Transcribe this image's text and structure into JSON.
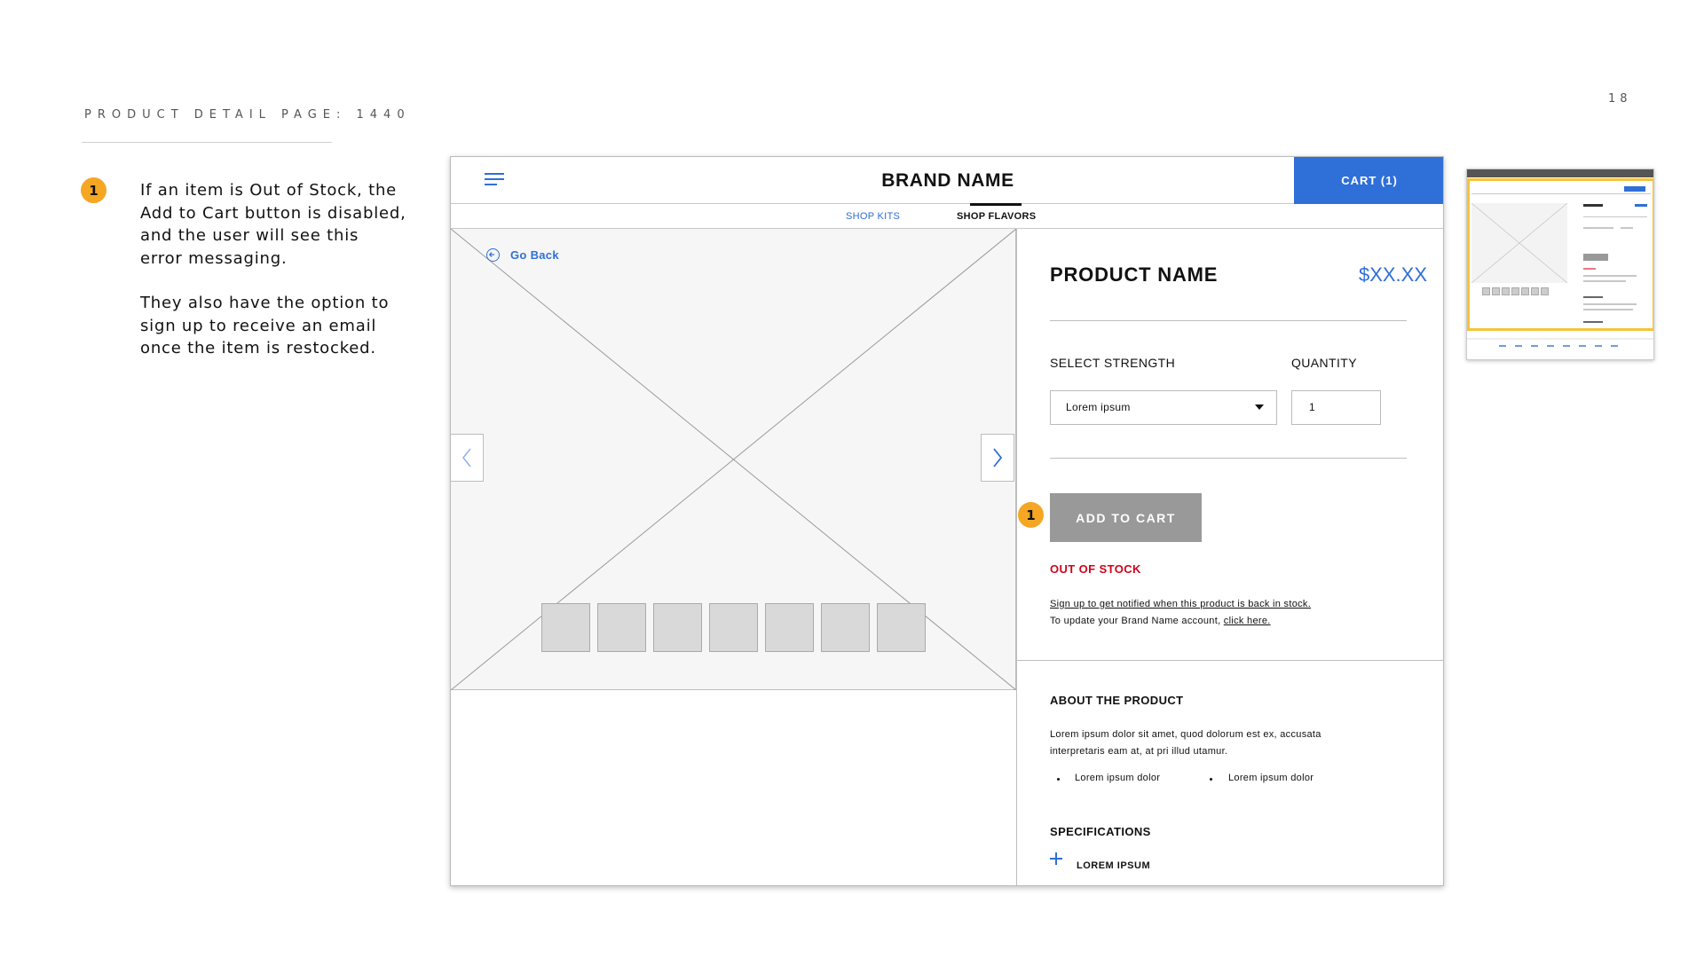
{
  "slide": {
    "title": "PRODUCT DETAIL PAGE: 1440",
    "page_number": "18",
    "annotation_badge": "1",
    "note_paragraph_1": "If an item is Out of Stock, the Add to Cart button is disabled, and the user will see this error messaging.",
    "note_paragraph_2": "They also have the option to sign up to receive an email once the item is restocked."
  },
  "header": {
    "brand": "BRAND NAME",
    "cart_label": "CART (1)"
  },
  "subnav": {
    "items": [
      {
        "label": "SHOP KITS"
      },
      {
        "label": "SHOP FLAVORS"
      }
    ]
  },
  "gallery": {
    "go_back": "Go Back",
    "thumbnail_count": 7
  },
  "product": {
    "name": "PRODUCT NAME",
    "price": "$XX.XX",
    "strength_label": "SELECT STRENGTH",
    "strength_value": "Lorem ipsum",
    "quantity_label": "QUANTITY",
    "quantity_value": "1",
    "add_to_cart": "ADD TO CART",
    "out_of_stock": "OUT OF STOCK",
    "notify_link": "Sign up to get notified when this product is back in stock.",
    "account_prefix": "To update your Brand Name account, ",
    "account_link": "click here."
  },
  "about": {
    "title": "ABOUT THE PRODUCT",
    "text": "Lorem ipsum dolor sit amet, quod dolorum est ex, accusata interpretaris eam at, at pri illud utamur.",
    "bullets": [
      "Lorem ipsum dolor",
      "Lorem ipsum dolor"
    ]
  },
  "specifications": {
    "title": "SPECIFICATIONS",
    "items": [
      "LOREM IPSUM"
    ]
  },
  "colors": {
    "accent_blue": "#2F6FD8",
    "badge_orange": "#F5A623",
    "error_red": "#D0021B",
    "disabled_gray": "#999999",
    "highlight_yellow": "#F5C33A"
  }
}
